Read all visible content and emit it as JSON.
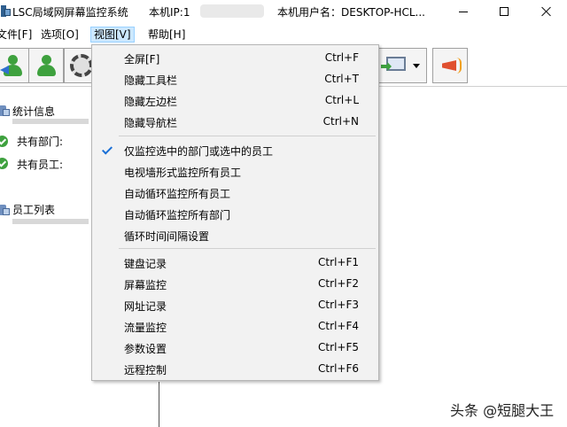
{
  "titlebar": {
    "title": "LSC局域网屏幕监控系统",
    "ip_label": "本机IP:1",
    "user_label": "本机用户名：DESKTOP-HCL..."
  },
  "menubar": {
    "items": [
      "文件[F]",
      "选项[O]",
      "视图[V]",
      "帮助[H]"
    ]
  },
  "panel": {
    "stats_title": "统计信息",
    "departments_label": "共有部门:",
    "employees_label": "共有员工:",
    "employee_list_title": "员工列表"
  },
  "view_menu": {
    "items": [
      {
        "label": "全屏[F]",
        "shortcut": "Ctrl+F"
      },
      {
        "label": "隐藏工具栏",
        "shortcut": "Ctrl+T"
      },
      {
        "label": "隐藏左边栏",
        "shortcut": "Ctrl+L"
      },
      {
        "label": "隐藏导航栏",
        "shortcut": "Ctrl+N"
      },
      {
        "label": "仅监控选中的部门或选中的员工",
        "shortcut": "",
        "checked": true
      },
      {
        "label": "电视墙形式监控所有员工",
        "shortcut": ""
      },
      {
        "label": "自动循环监控所有员工",
        "shortcut": ""
      },
      {
        "label": "自动循环监控所有部门",
        "shortcut": ""
      },
      {
        "label": "循环时间间隔设置",
        "shortcut": ""
      },
      {
        "label": "键盘记录",
        "shortcut": "Ctrl+F1"
      },
      {
        "label": "屏幕监控",
        "shortcut": "Ctrl+F2"
      },
      {
        "label": "网址记录",
        "shortcut": "Ctrl+F3"
      },
      {
        "label": "流量监控",
        "shortcut": "Ctrl+F4"
      },
      {
        "label": "参数设置",
        "shortcut": "Ctrl+F5"
      },
      {
        "label": "远程控制",
        "shortcut": "Ctrl+F6"
      }
    ]
  },
  "watermark": "头条 @短腿大王",
  "colors": {
    "menu_highlight": "#cce8ff",
    "check": "#1a6fd6"
  }
}
